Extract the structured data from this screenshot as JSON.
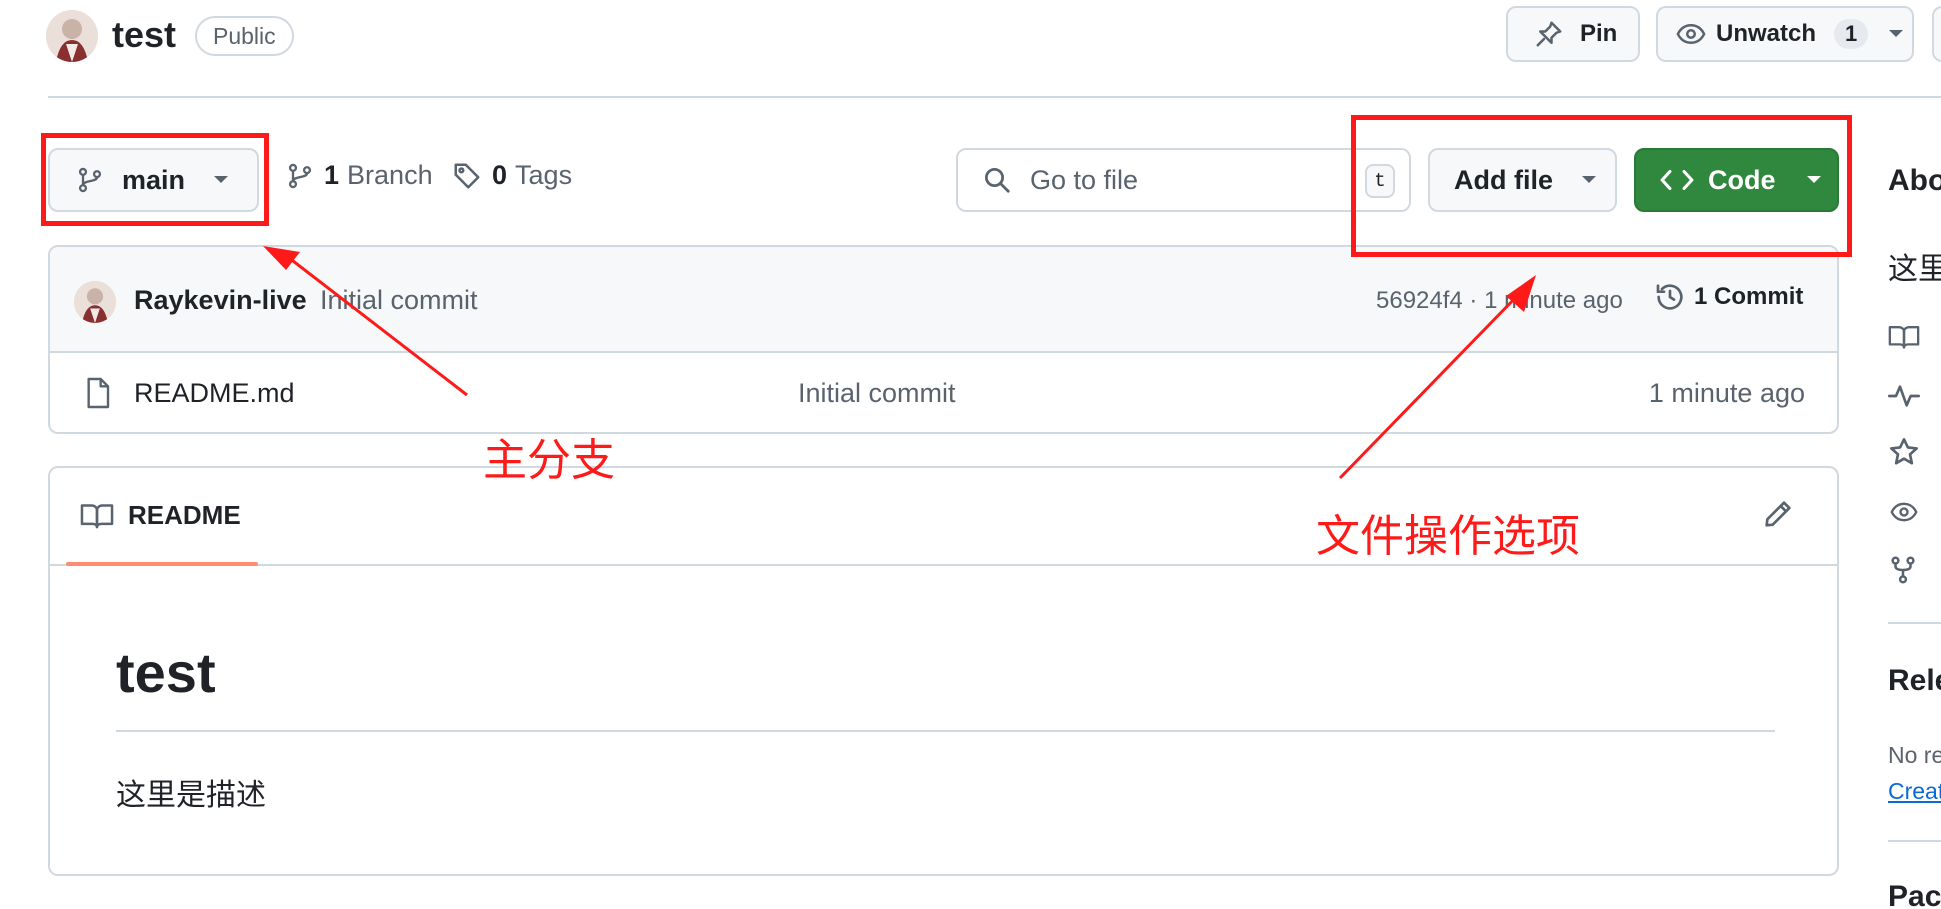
{
  "header": {
    "repo_name": "test",
    "visibility_badge": "Public",
    "pin_label": "Pin",
    "unwatch_label": "Unwatch",
    "watch_count": "1"
  },
  "toolbar": {
    "branch_name": "main",
    "branch_count": "1",
    "branch_label": "Branch",
    "tag_count": "0",
    "tag_label": "Tags",
    "search_placeholder": "Go to file",
    "search_shortcut": "t",
    "add_file_label": "Add file",
    "code_label": "Code"
  },
  "latest_commit": {
    "author": "Raykevin-live",
    "message": "Initial commit",
    "hash_time": "56924f4 · 1 minute ago",
    "commit_count_label": "1 Commit"
  },
  "files": [
    {
      "name": "README.md",
      "message": "Initial commit",
      "time": "1 minute ago"
    }
  ],
  "readme": {
    "tab_label": "README",
    "heading": "test",
    "body": "这里是描述"
  },
  "sidebar": {
    "about_title": "Abo",
    "description": "这里",
    "releases_title": "Rele",
    "no_releases": "No re",
    "create_link": "Creat",
    "packages_title": "Pac"
  },
  "annotations": {
    "branch_note": "主分支",
    "file_ops_note": "文件操作选项",
    "color": "#ff1a1a"
  },
  "colors": {
    "accent_green": "#2f883e",
    "tab_underline": "#fd8c73",
    "link_blue": "#0969da"
  }
}
